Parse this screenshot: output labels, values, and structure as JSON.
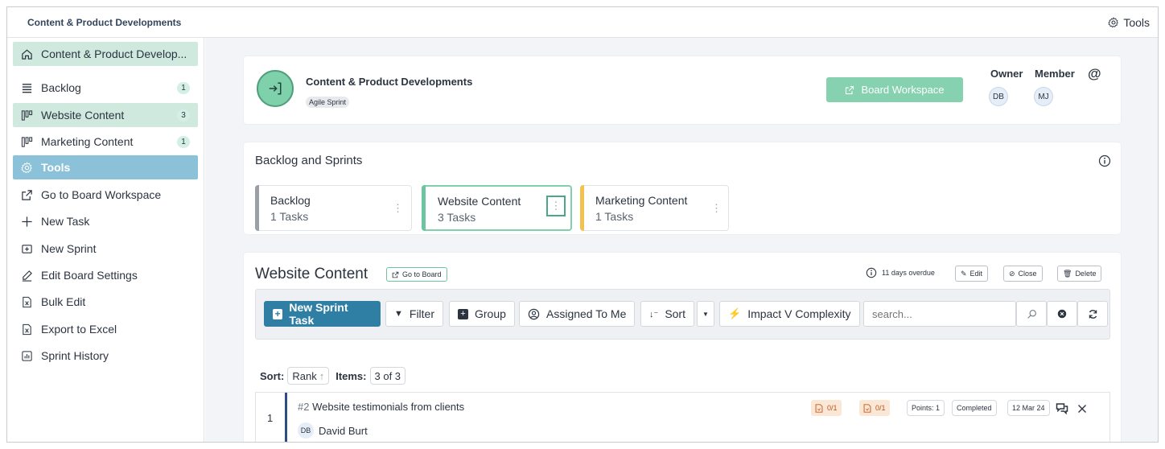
{
  "topbar": {
    "breadcrumb": "Content & Product Developments",
    "tools_label": "Tools"
  },
  "sidebar": {
    "items": [
      {
        "label": "Content & Product Develop...",
        "icon": "home-icon",
        "badge": ""
      },
      {
        "label": "Backlog",
        "icon": "list-icon",
        "badge": "1"
      },
      {
        "label": "Website Content",
        "icon": "board-icon",
        "badge": "3"
      },
      {
        "label": "Marketing Content",
        "icon": "board-icon",
        "badge": "1"
      },
      {
        "label": "Tools",
        "icon": "gear-icon",
        "badge": ""
      },
      {
        "label": "Go to Board Workspace",
        "icon": "external-link-icon",
        "badge": ""
      },
      {
        "label": "New Task",
        "icon": "plus-icon",
        "badge": ""
      },
      {
        "label": "New Sprint",
        "icon": "plus-square-icon",
        "badge": ""
      },
      {
        "label": "Edit Board Settings",
        "icon": "edit-icon",
        "badge": ""
      },
      {
        "label": "Bulk Edit",
        "icon": "excel-icon",
        "badge": ""
      },
      {
        "label": "Export to Excel",
        "icon": "excel-icon",
        "badge": ""
      },
      {
        "label": "Sprint History",
        "icon": "chart-icon",
        "badge": ""
      }
    ]
  },
  "header_card": {
    "title": "Content & Product Developments",
    "tag": "Agile Sprint",
    "workspace_button": "Board Workspace",
    "owner_label": "Owner",
    "member_label": "Member",
    "owner_initials": "DB",
    "member_initials": "MJ",
    "mention_symbol": "@"
  },
  "backlog_card": {
    "title": "Backlog and Sprints",
    "sprints": [
      {
        "name": "Backlog",
        "count": "1 Tasks",
        "color": "#9aa0a6"
      },
      {
        "name": "Website Content",
        "count": "3 Tasks",
        "color": "#6cc4a1"
      },
      {
        "name": "Marketing Content",
        "count": "1 Tasks",
        "color": "#f2c14e"
      }
    ]
  },
  "sprint_card": {
    "title": "Website Content",
    "goto_board": "Go to Board",
    "overdue": "11 days overdue",
    "edit": "Edit",
    "close": "Close",
    "delete": "Delete",
    "toolbar": {
      "new_task": "New Sprint Task",
      "filter": "Filter",
      "group": "Group",
      "assigned": "Assigned To Me",
      "sort": "Sort",
      "impact": "Impact V Complexity",
      "search_placeholder": "search..."
    },
    "sort_label": "Sort:",
    "sort_value": "Rank",
    "items_label": "Items:",
    "items_value": "3 of 3",
    "task": {
      "rank": "1",
      "id": "#2",
      "title": "Website testimonials from clients",
      "assignee_initials": "DB",
      "assignee_name": "David Burt",
      "checklist_1": "0/1",
      "checklist_2": "0/1",
      "points": "Points: 1",
      "status": "Completed",
      "date": "12 Mar 24"
    }
  },
  "colors": {
    "accent_teal": "#6cc4a1",
    "primary_blue": "#2f7ea3",
    "tools_active": "#8cc2d9"
  }
}
